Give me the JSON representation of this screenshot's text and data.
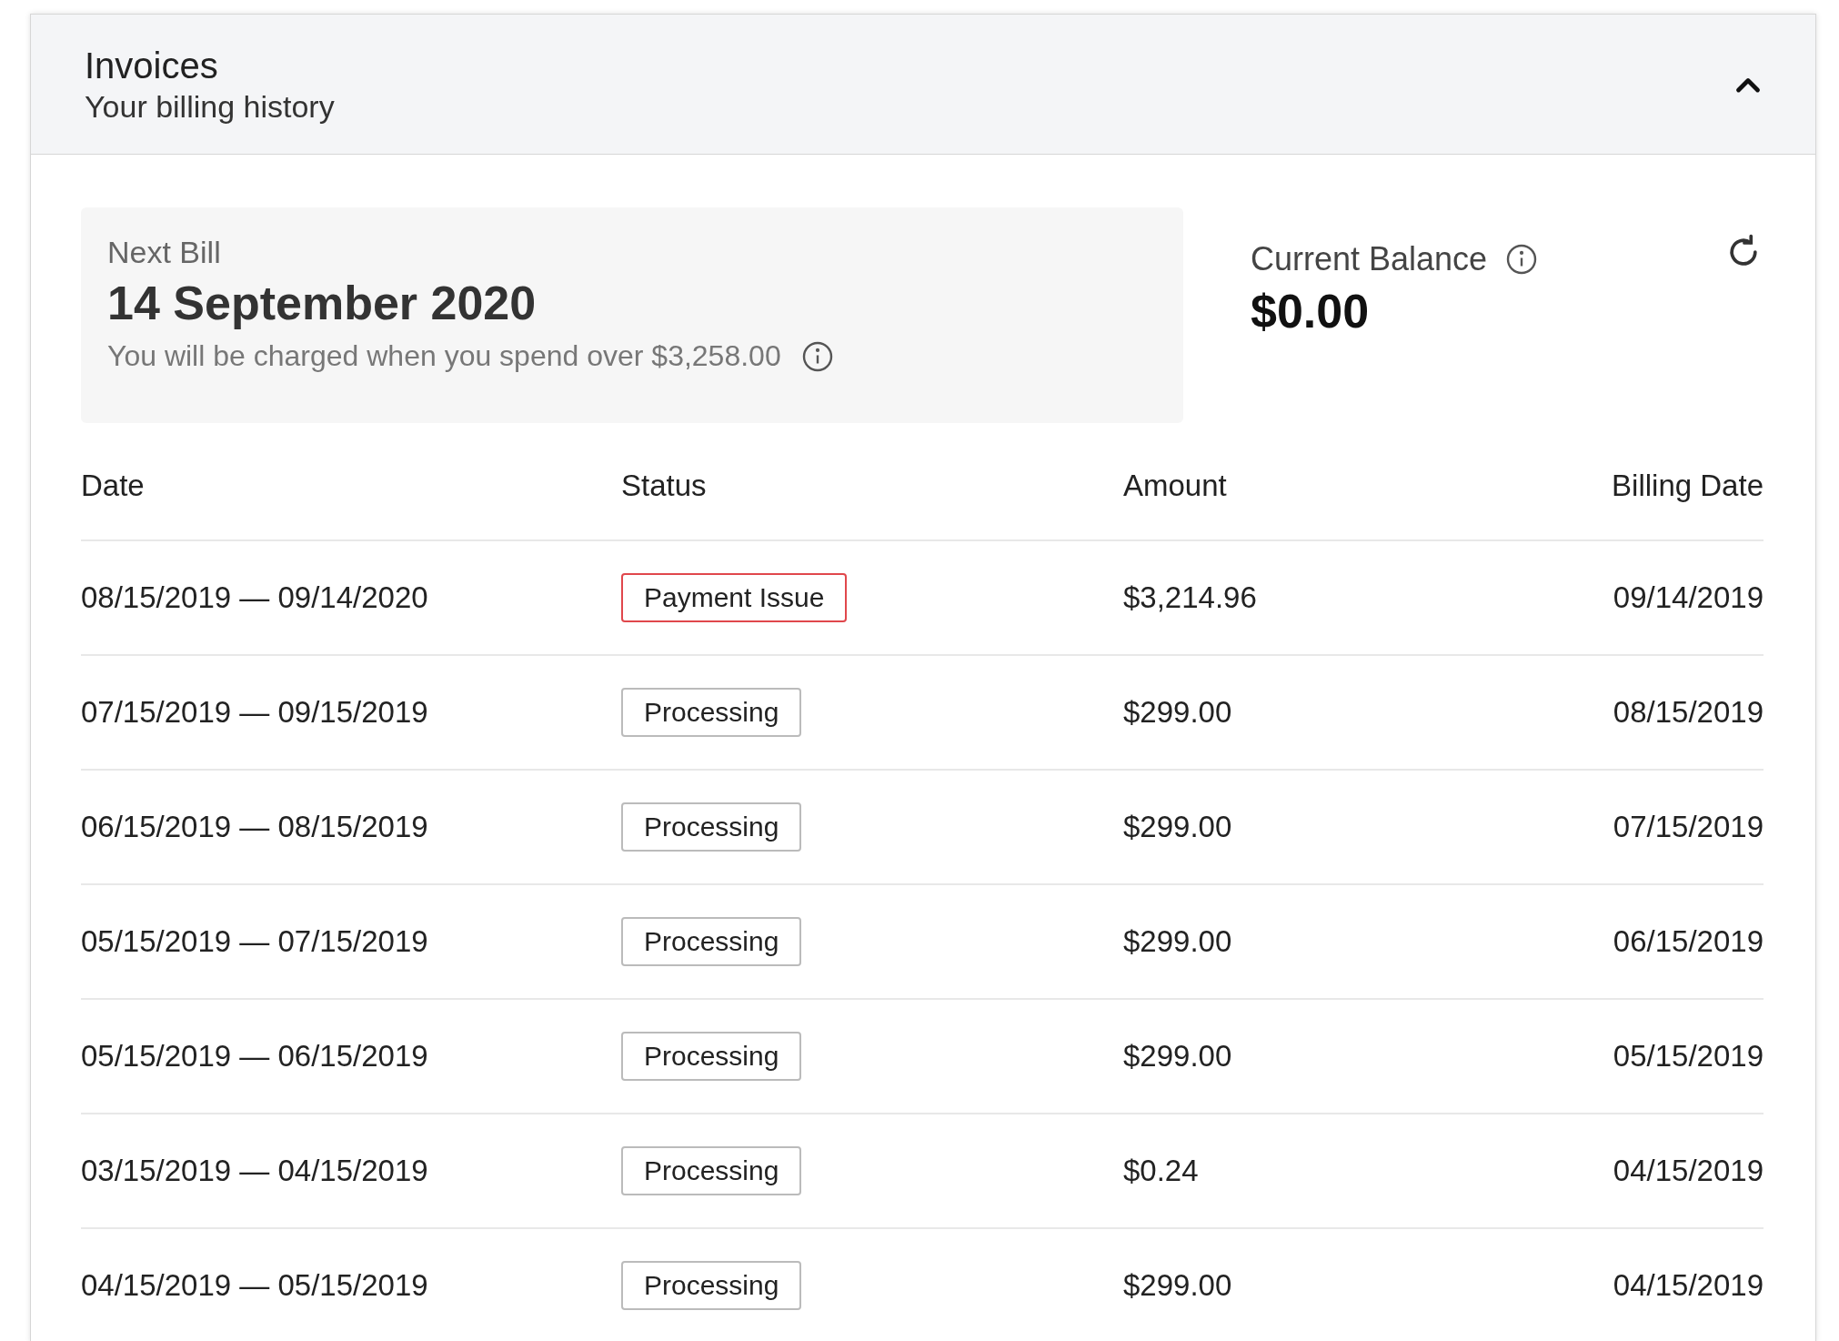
{
  "header": {
    "title": "Invoices",
    "subtitle": "Your billing history",
    "expanded": true
  },
  "next_bill": {
    "label": "Next Bill",
    "date": "14 September 2020",
    "note": "You will be charged when you spend over $3,258.00"
  },
  "balance": {
    "label": "Current Balance",
    "amount": "$0.00"
  },
  "table": {
    "columns": [
      "Date",
      "Status",
      "Amount",
      "Billing Date"
    ],
    "rows": [
      {
        "date": "08/15/2019 — 09/14/2020",
        "status": {
          "label": "Payment Issue",
          "kind": "error"
        },
        "amount": "$3,214.96",
        "billing_date": "09/14/2019"
      },
      {
        "date": "07/15/2019 — 09/15/2019",
        "status": {
          "label": "Processing",
          "kind": "neutral"
        },
        "amount": "$299.00",
        "billing_date": "08/15/2019"
      },
      {
        "date": "06/15/2019 — 08/15/2019",
        "status": {
          "label": "Processing",
          "kind": "neutral"
        },
        "amount": "$299.00",
        "billing_date": "07/15/2019"
      },
      {
        "date": "05/15/2019 — 07/15/2019",
        "status": {
          "label": "Processing",
          "kind": "neutral"
        },
        "amount": "$299.00",
        "billing_date": "06/15/2019"
      },
      {
        "date": "05/15/2019 — 06/15/2019",
        "status": {
          "label": "Processing",
          "kind": "neutral"
        },
        "amount": "$299.00",
        "billing_date": "05/15/2019"
      },
      {
        "date": "03/15/2019 — 04/15/2019",
        "status": {
          "label": "Processing",
          "kind": "neutral"
        },
        "amount": "$0.24",
        "billing_date": "04/15/2019"
      },
      {
        "date": "04/15/2019 — 05/15/2019",
        "status": {
          "label": "Processing",
          "kind": "neutral"
        },
        "amount": "$299.00",
        "billing_date": "04/15/2019"
      }
    ]
  }
}
